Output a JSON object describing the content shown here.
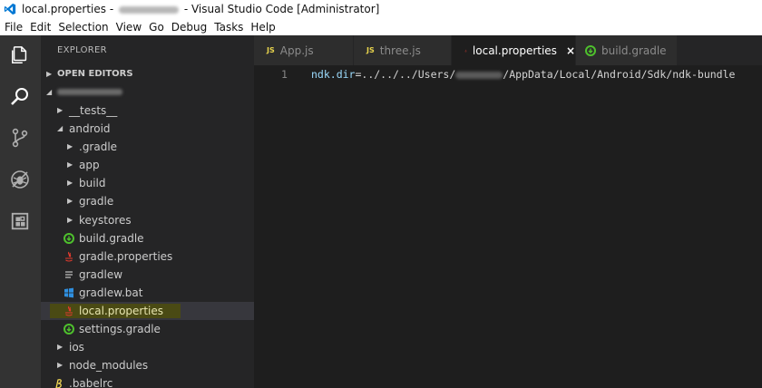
{
  "window": {
    "title_prefix": "local.properties -",
    "title_suffix": "- Visual Studio Code [Administrator]"
  },
  "menu": [
    "File",
    "Edit",
    "Selection",
    "View",
    "Go",
    "Debug",
    "Tasks",
    "Help"
  ],
  "activity_bar": [
    "explorer-icon",
    "search-icon",
    "source-control-icon",
    "debug-icon",
    "extensions-icon"
  ],
  "sidebar": {
    "title": "EXPLORER",
    "open_editors": "OPEN EDITORS",
    "tree": [
      {
        "label": "__tests__",
        "type": "folder",
        "state": "collapsed",
        "depth": 1
      },
      {
        "label": "android",
        "type": "folder",
        "state": "expanded",
        "depth": 1
      },
      {
        "label": ".gradle",
        "type": "folder",
        "state": "collapsed",
        "depth": 2
      },
      {
        "label": "app",
        "type": "folder",
        "state": "collapsed",
        "depth": 2
      },
      {
        "label": "build",
        "type": "folder",
        "state": "collapsed",
        "depth": 2
      },
      {
        "label": "gradle",
        "type": "folder",
        "state": "collapsed",
        "depth": 2
      },
      {
        "label": "keystores",
        "type": "folder",
        "state": "collapsed",
        "depth": 2
      },
      {
        "label": "build.gradle",
        "type": "file",
        "icon": "gradle-icon",
        "depth": 2
      },
      {
        "label": "gradle.properties",
        "type": "file",
        "icon": "java-properties-icon",
        "depth": 2
      },
      {
        "label": "gradlew",
        "type": "file",
        "icon": "text-lines-icon",
        "depth": 2
      },
      {
        "label": "gradlew.bat",
        "type": "file",
        "icon": "windows-icon",
        "depth": 2
      },
      {
        "label": "local.properties",
        "type": "file",
        "icon": "java-properties-icon",
        "depth": 2,
        "selected": true
      },
      {
        "label": "settings.gradle",
        "type": "file",
        "icon": "gradle-icon",
        "depth": 2
      },
      {
        "label": "ios",
        "type": "folder",
        "state": "collapsed",
        "depth": 1
      },
      {
        "label": "node_modules",
        "type": "folder",
        "state": "collapsed",
        "depth": 1
      },
      {
        "label": ".babelrc",
        "type": "file",
        "icon": "babel-icon",
        "depth": 1
      }
    ]
  },
  "tabs": [
    {
      "label": "App.js",
      "badge": "JS",
      "active": false
    },
    {
      "label": "three.js",
      "badge": "JS",
      "active": false
    },
    {
      "label": "local.properties",
      "badge": "",
      "active": true,
      "close": "×"
    },
    {
      "label": "build.gradle",
      "badge": "",
      "active": false
    }
  ],
  "editor": {
    "line_number": "1",
    "key": "ndk.dir",
    "equals": "=",
    "value_start": "../../../Users/",
    "value_end": "/AppData/Local/Android/Sdk/ndk-bundle"
  },
  "colors": {
    "activity_bar": "#333333",
    "sidebar": "#252526",
    "editor": "#1e1e1e",
    "highlight": "#4a4a14",
    "accent_blue": "#0078d4",
    "gradle_green": "#4ec02d"
  }
}
